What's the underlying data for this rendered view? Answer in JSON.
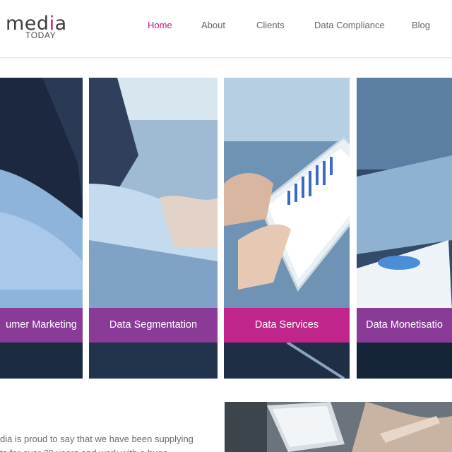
{
  "logo": {
    "main_prefix": "med",
    "main_accent": "i",
    "main_suffix": "a",
    "sub": "TODAY"
  },
  "nav": {
    "items": [
      {
        "label": "Home",
        "active": true
      },
      {
        "label": "About",
        "active": false
      },
      {
        "label": "Clients",
        "active": false
      },
      {
        "label": "Data Compliance",
        "active": false
      },
      {
        "label": "Blog",
        "active": false
      }
    ]
  },
  "panels": [
    {
      "label": "umer Marketing"
    },
    {
      "label": "Data Segmentation"
    },
    {
      "label": "Data Services",
      "featured": true
    },
    {
      "label": "Data Monetisatio"
    }
  ],
  "intro": {
    "line1": "dia is proud to say that we have been supplying",
    "line2": "ts for over 20 years and work with a huge"
  },
  "colors": {
    "accent": "#c2187a",
    "panel_label": "#8a3b98",
    "panel_label_featured": "#c0258b"
  }
}
